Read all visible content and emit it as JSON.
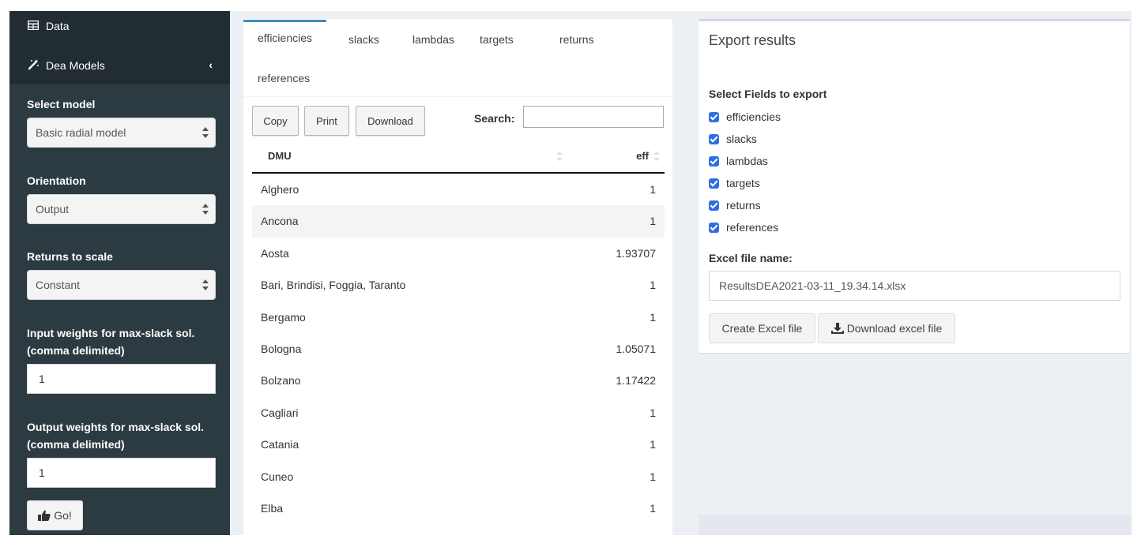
{
  "sidebar": {
    "menu": [
      {
        "label": "Data",
        "icon": "table-icon"
      },
      {
        "label": "Dea Models",
        "icon": "magic-wand-icon"
      }
    ],
    "select_model": {
      "label": "Select model",
      "value": "Basic radial model"
    },
    "orientation": {
      "label": "Orientation",
      "value": "Output"
    },
    "returns_to_scale": {
      "label": "Returns to scale",
      "value": "Constant"
    },
    "input_weights": {
      "label_line1": "Input weights for max-slack sol.",
      "label_line2": "(comma delimited)",
      "value": "1"
    },
    "output_weights": {
      "label_line1": "Output weights for max-slack sol.",
      "label_line2": "(comma delimited)",
      "value": "1"
    },
    "go_label": "Go!"
  },
  "results": {
    "tabs": [
      "efficiencies",
      "slacks",
      "lambdas",
      "targets",
      "returns",
      "references"
    ],
    "active_tab": "efficiencies",
    "buttons": {
      "copy": "Copy",
      "print": "Print",
      "download": "Download"
    },
    "search_label": "Search:",
    "search_value": "",
    "columns": [
      "DMU",
      "eff"
    ],
    "rows": [
      {
        "dmu": "Alghero",
        "eff": "1"
      },
      {
        "dmu": "Ancona",
        "eff": "1"
      },
      {
        "dmu": "Aosta",
        "eff": "1.93707"
      },
      {
        "dmu": "Bari, Brindisi, Foggia, Taranto",
        "eff": "1"
      },
      {
        "dmu": "Bergamo",
        "eff": "1"
      },
      {
        "dmu": "Bologna",
        "eff": "1.05071"
      },
      {
        "dmu": "Bolzano",
        "eff": "1.17422"
      },
      {
        "dmu": "Cagliari",
        "eff": "1"
      },
      {
        "dmu": "Catania",
        "eff": "1"
      },
      {
        "dmu": "Cuneo",
        "eff": "1"
      },
      {
        "dmu": "Elba",
        "eff": "1"
      }
    ]
  },
  "export": {
    "title": "Export results",
    "fields_label": "Select Fields to export",
    "fields": [
      "efficiencies",
      "slacks",
      "lambdas",
      "targets",
      "returns",
      "references"
    ],
    "file_label": "Excel file name:",
    "file_name": "ResultsDEA2021-03-11_19.34.14.xlsx",
    "create_label": "Create Excel file",
    "download_label": "Download excel file"
  },
  "colors": {
    "sidebar": "#222d32",
    "sidebar_sub": "#2c3b41",
    "accent": "#3c8dbc",
    "checkbox": "#2f6fe4",
    "background": "#ecf0f5"
  }
}
